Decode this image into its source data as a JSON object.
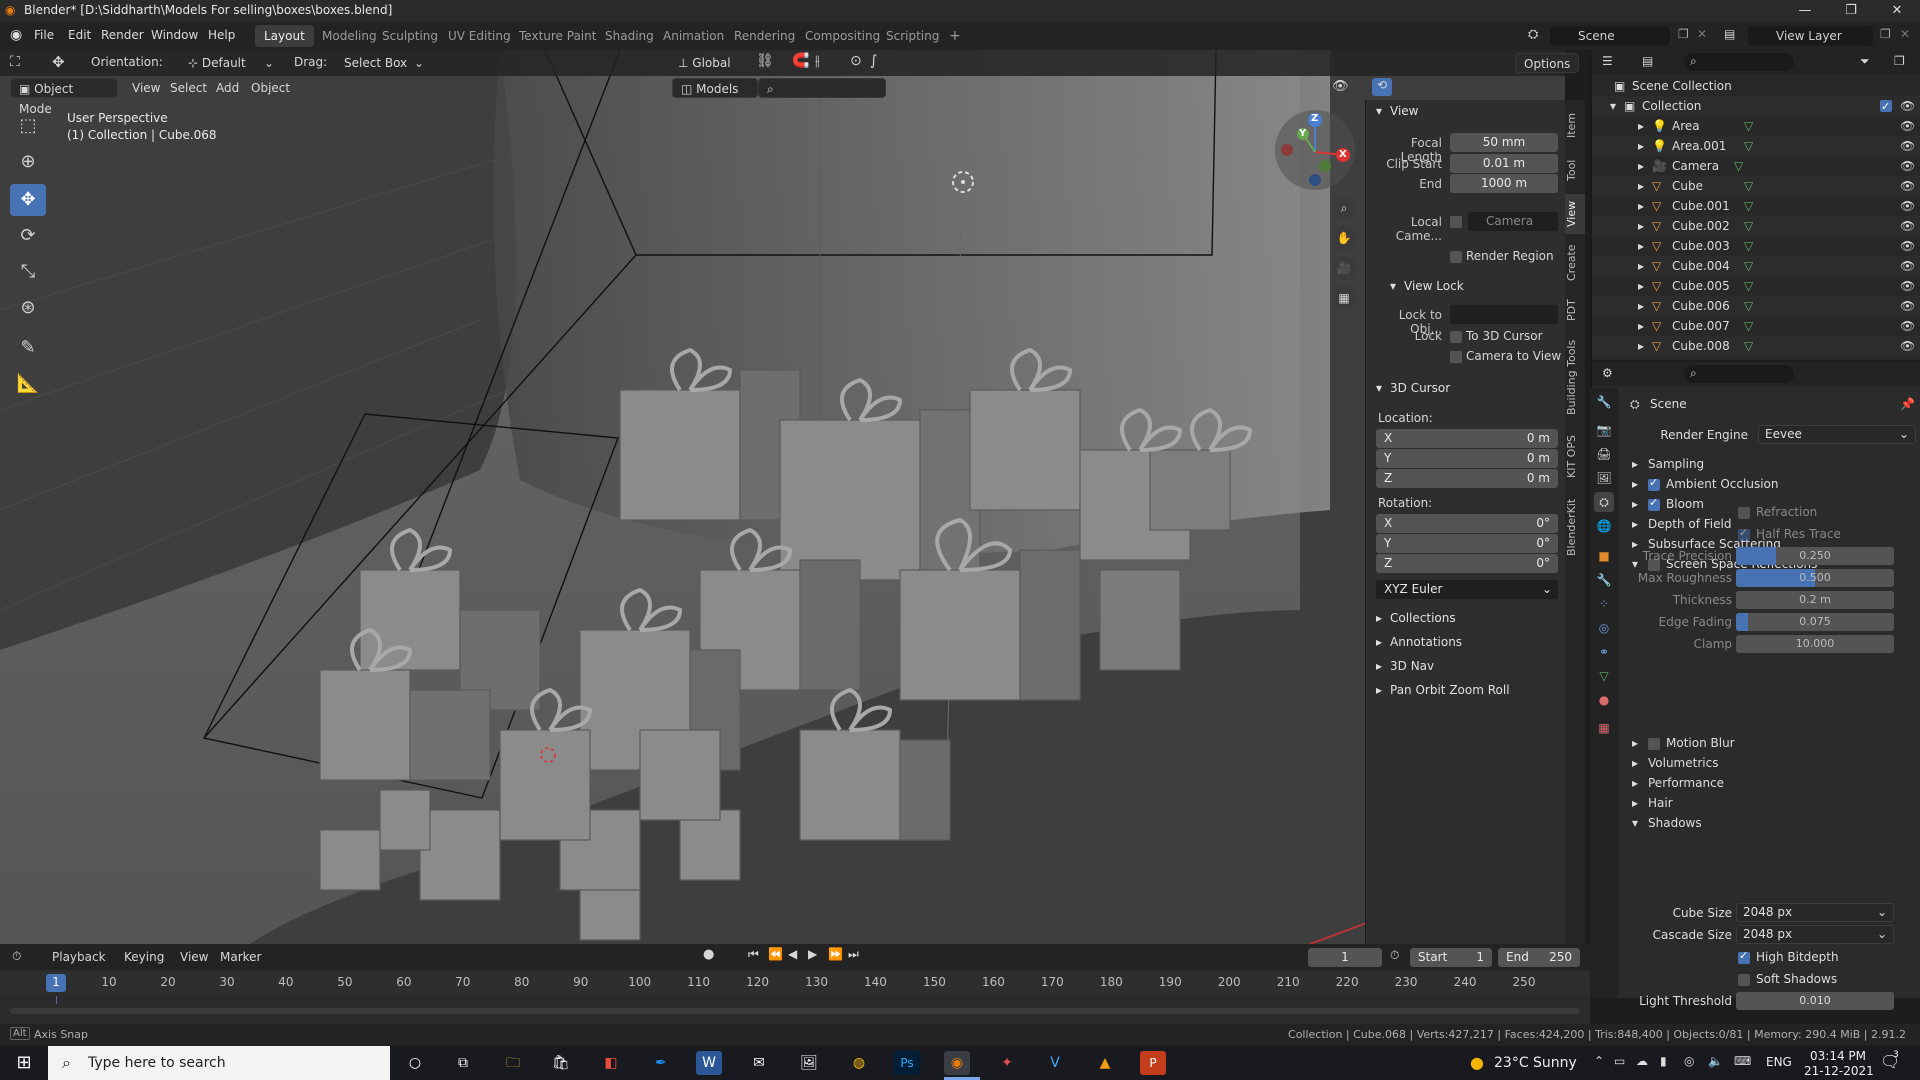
{
  "window": {
    "title": "Blender* [D:\\Siddharth\\Models For selling\\boxes\\boxes.blend]",
    "minimize": "—",
    "maximize": "❐",
    "close": "✕"
  },
  "menu": [
    "File",
    "Edit",
    "Render",
    "Window",
    "Help"
  ],
  "workspaces": [
    "Layout",
    "Modeling",
    "Sculpting",
    "UV Editing",
    "Texture Paint",
    "Shading",
    "Animation",
    "Rendering",
    "Compositing",
    "Scripting"
  ],
  "workspace_add": "+",
  "scene": {
    "name": "Scene",
    "view_layer": "View Layer"
  },
  "viewport_header": {
    "orientation_label": "Orientation:",
    "orientation_value": "Default",
    "drag_label": "Drag:",
    "drag_value": "Select Box",
    "transform": "Global",
    "options": "Options",
    "mode": "Object Mode",
    "menus": [
      "View",
      "Select",
      "Add",
      "Object"
    ],
    "models": "Models"
  },
  "viewport_info": {
    "line1": "User Perspective",
    "line2": "(1) Collection | Cube.068"
  },
  "gizmo": {
    "x": "X",
    "y": "Y",
    "z": "Z"
  },
  "npanel": {
    "view": {
      "header": "View",
      "focal_length_label": "Focal Length",
      "focal_length": "50 mm",
      "clip_start_label": "Clip Start",
      "clip_start": "0.01 m",
      "end_label": "End",
      "end": "1000 m",
      "local_camera_label": "Local Came...",
      "local_camera": "Camera",
      "render_region": "Render Region"
    },
    "view_lock": {
      "header": "View Lock",
      "lock_to_obj_label": "Lock to Obj...",
      "lock_label": "Lock",
      "to_3d_cursor": "To 3D Cursor",
      "camera_to_view": "Camera to View"
    },
    "cursor": {
      "header": "3D Cursor",
      "location_label": "Location:",
      "x_label": "X",
      "x": "0 m",
      "y_label": "Y",
      "y": "0 m",
      "z_label": "Z",
      "z": "0 m",
      "rotation_label": "Rotation:",
      "rx_label": "X",
      "rx": "0°",
      "ry_label": "Y",
      "ry": "0°",
      "rz_label": "Z",
      "rz": "0°",
      "rotation_mode": "XYZ Euler"
    },
    "collapsed": [
      "Collections",
      "Annotations",
      "3D Nav",
      "Pan Orbit Zoom Roll"
    ]
  },
  "side_tabs": [
    "Item",
    "Tool",
    "View",
    "Create",
    "PDT",
    "Building Tools",
    "KIT OPS",
    "BlenderKit"
  ],
  "outliner": {
    "root": "Scene Collection",
    "collection": "Collection",
    "items": [
      "Area",
      "Area.001",
      "Camera",
      "Cube",
      "Cube.001",
      "Cube.002",
      "Cube.003",
      "Cube.004",
      "Cube.005",
      "Cube.006",
      "Cube.007",
      "Cube.008"
    ]
  },
  "properties": {
    "context": "Scene",
    "render_engine_label": "Render Engine",
    "render_engine": "Eevee",
    "panels": [
      {
        "label": "Sampling",
        "checkbox": null
      },
      {
        "label": "Ambient Occlusion",
        "checkbox": true
      },
      {
        "label": "Bloom",
        "checkbox": true
      },
      {
        "label": "Depth of Field",
        "checkbox": null
      },
      {
        "label": "Subsurface Scattering",
        "checkbox": null
      },
      {
        "label": "Screen Space Reflections",
        "checkbox": false
      }
    ],
    "ssr": {
      "refraction": "Refraction",
      "half_res_trace": "Half Res Trace",
      "trace_precision_label": "Trace Precision",
      "trace_precision": "0.250",
      "trace_precision_fill": 0.25,
      "max_roughness_label": "Max Roughness",
      "max_roughness": "0.500",
      "max_roughness_fill": 0.5,
      "thickness_label": "Thickness",
      "thickness": "0.2 m",
      "edge_fading_label": "Edge Fading",
      "edge_fading": "0.075",
      "edge_fading_fill": 0.075,
      "clamp_label": "Clamp",
      "clamp": "10.000"
    },
    "panels2": [
      {
        "label": "Motion Blur",
        "checkbox": false
      },
      {
        "label": "Volumetrics",
        "checkbox": null
      },
      {
        "label": "Performance",
        "checkbox": null
      },
      {
        "label": "Hair",
        "checkbox": null
      },
      {
        "label": "Shadows",
        "checkbox": null
      }
    ],
    "shadows": {
      "cube_size_label": "Cube Size",
      "cube_size": "2048 px",
      "cascade_size_label": "Cascade Size",
      "cascade_size": "2048 px",
      "high_bitdepth": "High Bitdepth",
      "soft_shadows": "Soft Shadows",
      "light_threshold_label": "Light Threshold",
      "light_threshold": "0.010"
    }
  },
  "timeline": {
    "menus": [
      "Playback",
      "Keying",
      "View",
      "Marker"
    ],
    "current_frame": "1",
    "start_label": "Start",
    "start": "1",
    "end_label": "End",
    "end": "250",
    "ruler": [
      "1",
      "10",
      "20",
      "30",
      "40",
      "50",
      "60",
      "70",
      "80",
      "90",
      "100",
      "110",
      "120",
      "130",
      "140",
      "150",
      "160",
      "170",
      "180",
      "190",
      "200",
      "210",
      "220",
      "230",
      "240",
      "250"
    ]
  },
  "status": {
    "hint": "Axis Snap",
    "stats": "Collection | Cube.068 | Verts:427,217 | Faces:424,200 | Tris:848,400 | Objects:0/81 | Memory: 290.4 MiB | 2.91.2"
  },
  "taskbar": {
    "search_placeholder": "Type here to search",
    "weather": "23°C  Sunny",
    "lang": "ENG",
    "time": "03:14 PM",
    "date": "21-12-2021",
    "notification_count": "3"
  },
  "colors": {
    "accent": "#4772b3",
    "viewport": "#3e3e3e",
    "panel": "#2e2e2e"
  }
}
